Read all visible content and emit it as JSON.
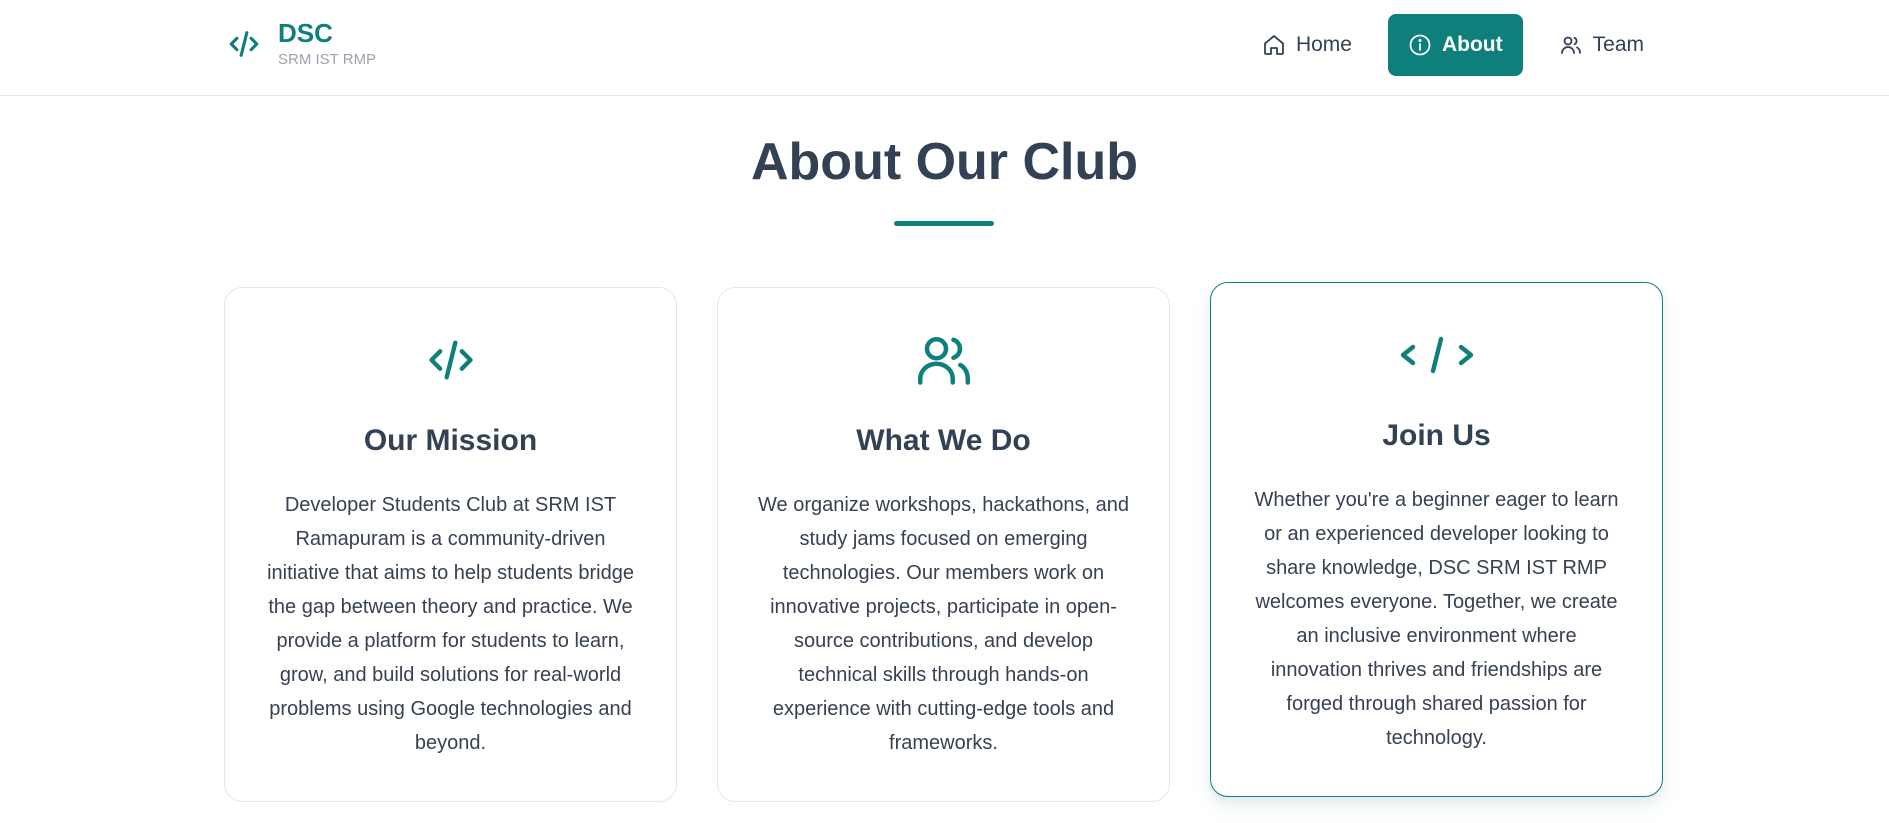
{
  "brand": {
    "title": "DSC",
    "subtitle": "SRM IST RMP",
    "icon": "code-icon",
    "color": "#0f7f7b"
  },
  "nav": {
    "items": [
      {
        "label": "Home",
        "icon": "home-icon",
        "active": false
      },
      {
        "label": "About",
        "icon": "info-icon",
        "active": true
      },
      {
        "label": "Team",
        "icon": "users-icon",
        "active": false
      }
    ]
  },
  "page": {
    "title": "About Our Club"
  },
  "cards": [
    {
      "icon": "code-icon",
      "title": "Our Mission",
      "text": "Developer Students Club at SRM IST Ramapuram is a community-driven initiative that aims to help students bridge the gap between theory and practice. We provide a platform for students to learn, grow, and build solutions for real-world problems using Google technologies and beyond."
    },
    {
      "icon": "users-icon",
      "title": "What We Do",
      "text": "We organize workshops, hackathons, and study jams focused on emerging technologies. Our members work on innovative projects, participate in open-source contributions, and develop technical skills through hands-on experience with cutting-edge tools and frameworks."
    },
    {
      "icon": "code-brackets-icon",
      "title": "Join Us",
      "text": "Whether you're a beginner eager to learn or an experienced developer looking to share knowledge, DSC SRM IST RMP welcomes everyone. Together, we create an inclusive environment where innovation thrives and friendships are forged through shared passion for technology."
    }
  ]
}
